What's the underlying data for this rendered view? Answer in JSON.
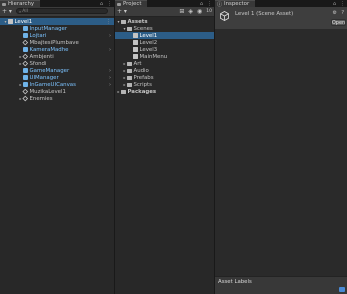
{
  "hierarchy": {
    "tab_label": "Hierarchy",
    "search_placeholder": "All",
    "add_label": "+ ▾",
    "rows": [
      {
        "label": "Level1",
        "depth": 0,
        "arrow": "▾",
        "icon": "scene-icon",
        "style": "selected"
      },
      {
        "label": "InputManager",
        "depth": 1,
        "arrow": "",
        "icon": "prefab-icon",
        "style": "blue",
        "chevron": false
      },
      {
        "label": "Lojtari",
        "depth": 1,
        "arrow": "",
        "icon": "prefab-icon",
        "style": "blue",
        "chevron": true
      },
      {
        "label": "MbajtesiPlumbave",
        "depth": 1,
        "arrow": "",
        "icon": "gameobject-icon",
        "style": "normal",
        "chevron": false
      },
      {
        "label": "KameraMadhe",
        "depth": 1,
        "arrow": "",
        "icon": "prefab-icon",
        "style": "blue",
        "chevron": true
      },
      {
        "label": "Ambjenti",
        "depth": 1,
        "arrow": "▸",
        "icon": "gameobject-icon",
        "style": "normal",
        "chevron": false
      },
      {
        "label": "Sfondi",
        "depth": 1,
        "arrow": "▸",
        "icon": "gameobject-icon",
        "style": "normal",
        "chevron": false
      },
      {
        "label": "GameManager",
        "depth": 1,
        "arrow": "",
        "icon": "prefab-icon",
        "style": "blue",
        "chevron": true
      },
      {
        "label": "UIManager",
        "depth": 1,
        "arrow": "",
        "icon": "prefab-icon",
        "style": "blue",
        "chevron": true
      },
      {
        "label": "InGameUICanvas",
        "depth": 1,
        "arrow": "▸",
        "icon": "prefab-icon",
        "style": "blue",
        "chevron": true
      },
      {
        "label": "MuzikaLevel1",
        "depth": 1,
        "arrow": "",
        "icon": "gameobject-icon",
        "style": "normal",
        "chevron": false
      },
      {
        "label": "Enemies",
        "depth": 1,
        "arrow": "▸",
        "icon": "gameobject-icon",
        "style": "normal",
        "chevron": false
      }
    ]
  },
  "project": {
    "tab_label": "Project",
    "rows": [
      {
        "label": "Assets",
        "depth": 0,
        "arrow": "▾",
        "icon": "folder-icon",
        "bold": true
      },
      {
        "label": "Scenes",
        "depth": 1,
        "arrow": "▾",
        "icon": "folder-icon",
        "bold": false
      },
      {
        "label": "Level1",
        "depth": 2,
        "arrow": "",
        "icon": "scene-icon",
        "bold": false,
        "selected": true
      },
      {
        "label": "Level2",
        "depth": 2,
        "arrow": "",
        "icon": "scene-icon",
        "bold": false
      },
      {
        "label": "Level3",
        "depth": 2,
        "arrow": "",
        "icon": "scene-icon",
        "bold": false
      },
      {
        "label": "MainMenu",
        "depth": 2,
        "arrow": "",
        "icon": "scene-icon",
        "bold": false
      },
      {
        "label": "Art",
        "depth": 1,
        "arrow": "▸",
        "icon": "folder-icon",
        "bold": false
      },
      {
        "label": "Audio",
        "depth": 1,
        "arrow": "▸",
        "icon": "folder-icon",
        "bold": false
      },
      {
        "label": "Prefabs",
        "depth": 1,
        "arrow": "▸",
        "icon": "folder-icon",
        "bold": false
      },
      {
        "label": "Scripts",
        "depth": 1,
        "arrow": "▸",
        "icon": "folder-icon",
        "bold": false
      },
      {
        "label": "Packages",
        "depth": 0,
        "arrow": "▸",
        "icon": "folder-icon",
        "bold": true
      }
    ],
    "toolbar_add": "+ ▾",
    "toolbar_count": "10"
  },
  "inspector": {
    "tab_label": "Inspector",
    "asset_title": "Level 1 (Scene Asset)",
    "open_button": "Open",
    "asset_labels_title": "Asset Labels"
  },
  "colors": {
    "selection": "#2c5d87",
    "prefab_text": "#7cc3ff"
  }
}
